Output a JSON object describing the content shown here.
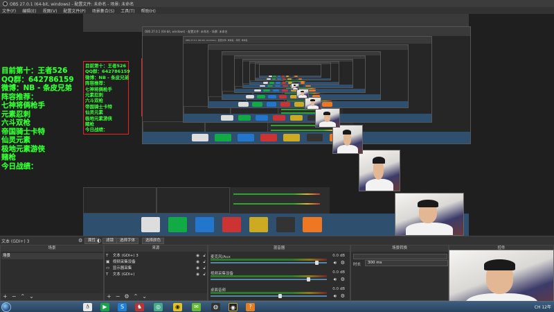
{
  "window": {
    "title": "OBS 27.0.1 (64-bit, windows) - 配置文件: 未命名 - 场景: 未命名"
  },
  "menu": [
    "文件(F)",
    "编辑(E)",
    "视图(V)",
    "配置文件(P)",
    "场景集合(S)",
    "工具(T)",
    "帮助(H)"
  ],
  "overlay": {
    "lines": [
      "目前第十：王者526",
      "QQ群：642786159",
      "微博：NB - 条皮兄弟",
      "阵容推荐：",
      "七神将俩枪手",
      "元素忍刺",
      "六斗双枪",
      "帝国骑士卡特",
      "仙灵元素",
      "极地元素游侠",
      "赌枪",
      "今日战绩："
    ]
  },
  "nested_title": "OBS 27.0.1 (64-bit, windows) - 配置文件: 未命名 - 场景: 未命名",
  "toolbar": {
    "source_label": "文本 (GDI+) 3",
    "properties": "属性",
    "filters": "滤镜",
    "select_font": "选择字体",
    "select_color": "选择颜色"
  },
  "docks": {
    "scenes": {
      "title": "场景",
      "items": [
        "场景"
      ]
    },
    "sources": {
      "title": "来源",
      "items": [
        {
          "icon": "T",
          "name": "文本 (GDI+) 3"
        },
        {
          "icon": "▣",
          "name": "视频采集设备"
        },
        {
          "icon": "▭",
          "name": "显示器采集"
        },
        {
          "icon": "T",
          "name": "文本 (GDI+)"
        }
      ]
    },
    "mixer": {
      "title": "混音器",
      "channels": [
        {
          "name": "麦克风/Aux",
          "db": "0.0 dB",
          "level": 0.92
        },
        {
          "name": "视频采集设备",
          "db": "0.0 dB",
          "level": 0.85
        },
        {
          "name": "桌面音频",
          "db": "0.0 dB",
          "level": 0.6
        }
      ]
    },
    "transitions": {
      "title": "场景转换",
      "duration_label": "时长",
      "duration_value": "300 ms"
    },
    "controls": {
      "title": "控件"
    }
  },
  "taskbar": {
    "tray_text": "CH 12年"
  }
}
